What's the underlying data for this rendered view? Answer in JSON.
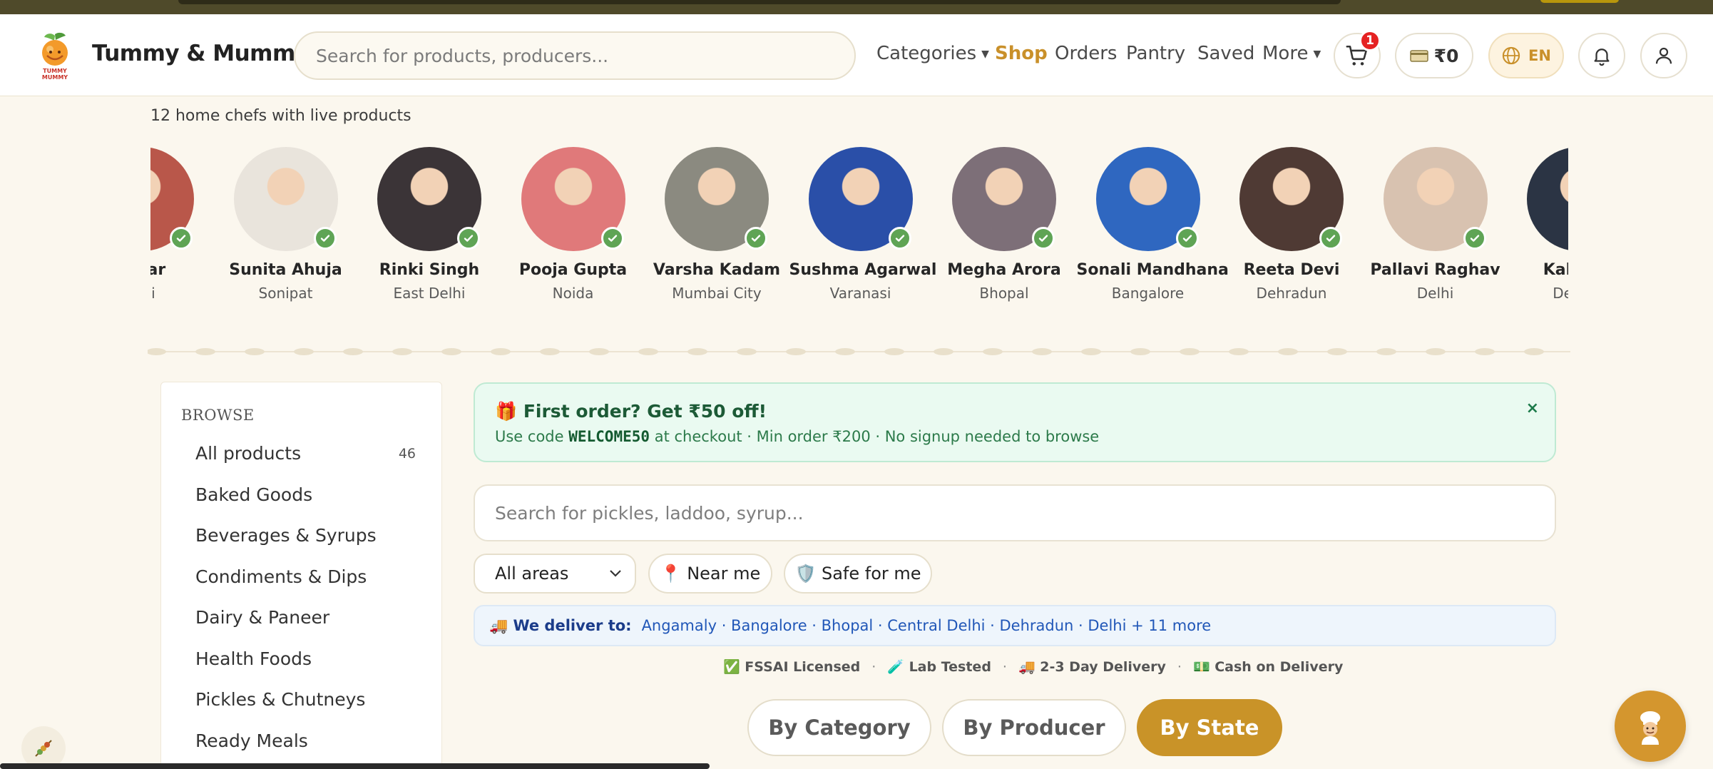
{
  "header": {
    "brand": "Tummy & Mummy",
    "logo_text": "TUMMY MUMMY",
    "search_placeholder": "Search for products, producers...",
    "nav": {
      "categories": "Categories",
      "shop": "Shop",
      "orders": "Orders",
      "pantry": "Pantry",
      "saved": "Saved",
      "more": "More"
    },
    "cart_count": "1",
    "wallet": "₹0",
    "language": "EN"
  },
  "chefs": {
    "subtitle": "12 home chefs with live products",
    "list": [
      {
        "name": "...nar",
        "city": "...hi",
        "color": "#b9574a"
      },
      {
        "name": "Sunita Ahuja",
        "city": "Sonipat",
        "color": "#e9e4dc"
      },
      {
        "name": "Rinki Singh",
        "city": "East Delhi",
        "color": "#3b3437"
      },
      {
        "name": "Pooja Gupta",
        "city": "Noida",
        "color": "#e0797a"
      },
      {
        "name": "Varsha Kadam",
        "city": "Mumbai City",
        "color": "#8b8a80"
      },
      {
        "name": "Sushma Agarwal",
        "city": "Varanasi",
        "color": "#2a4fa8"
      },
      {
        "name": "Megha Arora",
        "city": "Bhopal",
        "color": "#7d6f78"
      },
      {
        "name": "Sonali Mandhana",
        "city": "Bangalore",
        "color": "#2f67c0"
      },
      {
        "name": "Reeta Devi",
        "city": "Dehradun",
        "color": "#4f3a34"
      },
      {
        "name": "Pallavi Raghav",
        "city": "Delhi",
        "color": "#d8c2b0"
      },
      {
        "name": "Kalpana",
        "city": "Dehrad",
        "color": "#2b3444"
      }
    ]
  },
  "sidebar": {
    "heading": "BROWSE",
    "items": [
      {
        "label": "All products",
        "count": "46"
      },
      {
        "label": "Baked Goods"
      },
      {
        "label": "Beverages & Syrups"
      },
      {
        "label": "Condiments & Dips"
      },
      {
        "label": "Dairy & Paneer"
      },
      {
        "label": "Health Foods"
      },
      {
        "label": "Pickles & Chutneys"
      },
      {
        "label": "Ready Meals"
      }
    ]
  },
  "promo": {
    "title": "🎁 First order? Get ₹50 off!",
    "line_pre": "Use code ",
    "code": "WELCOME50",
    "line_post": " at checkout · Min order ₹200 · No signup needed to browse",
    "close": "×"
  },
  "main": {
    "search_placeholder": "Search for pickles, laddoo, syrup...",
    "areas_select": "All areas",
    "near_me": "📍 Near me",
    "safe_for_me": "🛡️ Safe for me",
    "deliver_label": "🚚 We deliver to:",
    "deliver_list": "Angamaly · Bangalore · Bhopal · Central Delhi · Dehradun · Delhi + 11 more",
    "trust": [
      "✅ FSSAI Licensed",
      "🧪 Lab Tested",
      "🚚 2-3 Day Delivery",
      "💵 Cash on Delivery"
    ],
    "trust_sep": "·",
    "tabs": {
      "by_category": "By Category",
      "by_producer": "By Producer",
      "by_state": "By State"
    }
  },
  "colors": {
    "accent": "#c99328",
    "promo_bg": "#eafaf1",
    "deliver_bg": "#eef5fc",
    "verified": "#5fa455",
    "badge": "#e52222"
  }
}
